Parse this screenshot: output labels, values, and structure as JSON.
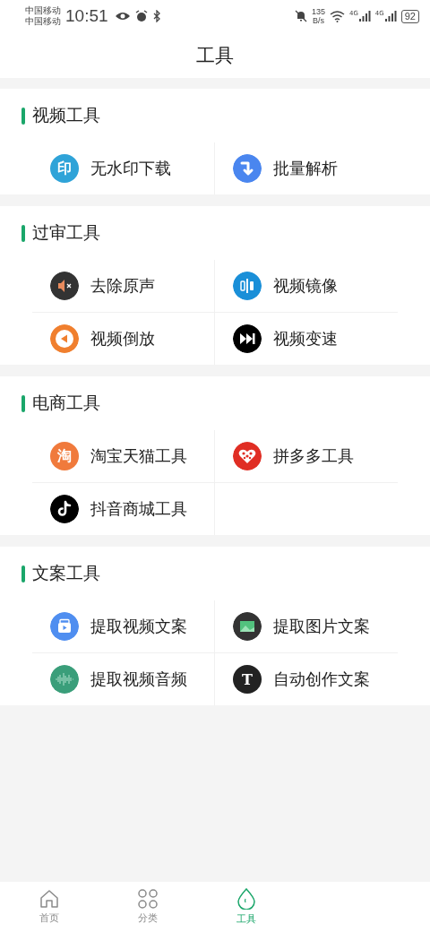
{
  "status_bar": {
    "carriers": [
      "中国移动",
      "中国移动"
    ],
    "time": "10:51",
    "net_speed": "135",
    "net_unit": "B/s",
    "network_labels": [
      "4G",
      "4G"
    ],
    "battery": "92"
  },
  "header": {
    "title": "工具"
  },
  "sections": [
    {
      "title": "视频工具",
      "tools": [
        {
          "label": "无水印下载",
          "kind": "watermark",
          "glyph": "印"
        },
        {
          "label": "批量解析",
          "kind": "batch"
        }
      ]
    },
    {
      "title": "过审工具",
      "tools": [
        {
          "label": "去除原声",
          "kind": "mute"
        },
        {
          "label": "视频镜像",
          "kind": "mirror"
        },
        {
          "label": "视频倒放",
          "kind": "reverse"
        },
        {
          "label": "视频变速",
          "kind": "speed"
        }
      ]
    },
    {
      "title": "电商工具",
      "tools": [
        {
          "label": "淘宝天猫工具",
          "kind": "taobao",
          "glyph": "淘"
        },
        {
          "label": "拼多多工具",
          "kind": "pdd"
        },
        {
          "label": "抖音商城工具",
          "kind": "douyin"
        }
      ]
    },
    {
      "title": "文案工具",
      "tools": [
        {
          "label": "提取视频文案",
          "kind": "video-text"
        },
        {
          "label": "提取图片文案",
          "kind": "image-text"
        },
        {
          "label": "提取视频音频",
          "kind": "audio"
        },
        {
          "label": "自动创作文案",
          "kind": "write",
          "glyph": "T"
        }
      ]
    }
  ],
  "tab_bar": [
    {
      "label": "首页",
      "kind": "home",
      "selected": false
    },
    {
      "label": "分类",
      "kind": "grid",
      "selected": false
    },
    {
      "label": "工具",
      "kind": "drop",
      "selected": true
    }
  ]
}
